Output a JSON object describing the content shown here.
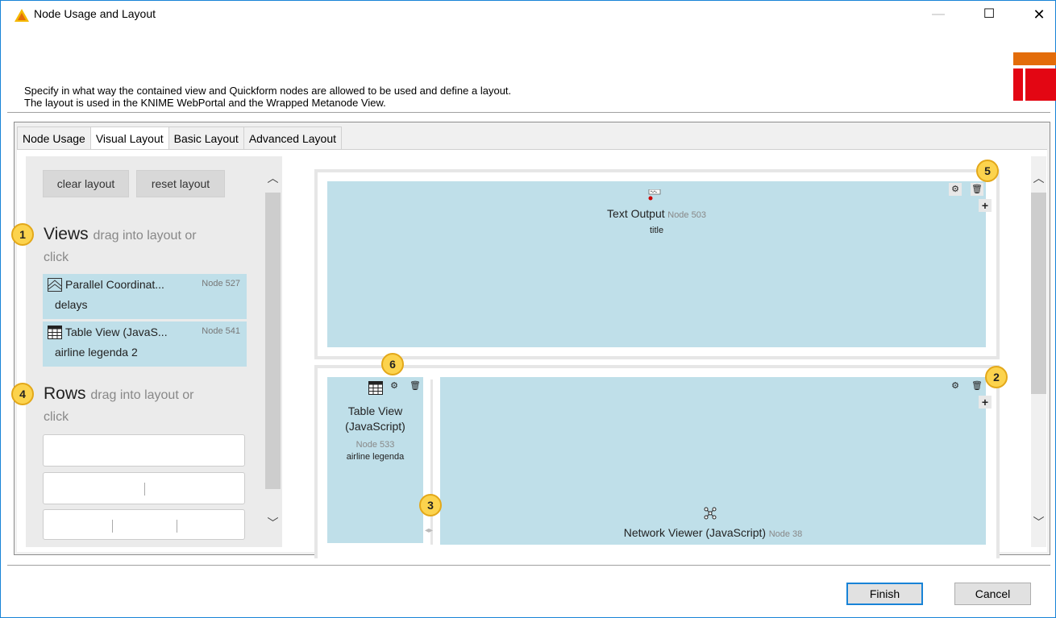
{
  "window": {
    "title": "Node Usage and Layout",
    "minimize": "—",
    "maximize": "☐",
    "close": "✕"
  },
  "header": {
    "line1": "Specify in what way the contained view and Quickform nodes are allowed to be used and define a layout.",
    "line2": "The layout is used in the KNIME WebPortal and the Wrapped Metanode View."
  },
  "tabs": [
    "Node Usage",
    "Visual Layout",
    "Basic Layout",
    "Advanced Layout"
  ],
  "left_panel": {
    "clear_label": "clear layout",
    "reset_label": "reset layout",
    "views_title": "Views",
    "views_hint": "drag into layout or",
    "views_click": "click",
    "views": [
      {
        "name": "Parallel Coordinat...",
        "node": "Node 527",
        "sub": "delays",
        "icon": "parallel-coordinates-icon"
      },
      {
        "name": "Table View (JavaS...",
        "node": "Node 541",
        "sub": "airline legenda 2",
        "icon": "table-icon"
      }
    ],
    "rows_title": "Rows",
    "rows_hint": "drag into layout or",
    "rows_click": "click"
  },
  "layout": {
    "row1": {
      "name": "Text Output",
      "node": "Node 503",
      "sub": "title",
      "icon": "text-output-icon"
    },
    "row2_col1": {
      "name1": "Table View",
      "name2": "(JavaScript)",
      "node": "Node 533",
      "sub": "airline legenda",
      "icon": "table-icon"
    },
    "row2_col2": {
      "name": "Network Viewer (JavaScript)",
      "node": "Node 38",
      "icon": "network-icon"
    }
  },
  "callouts": [
    "1",
    "2",
    "3",
    "4",
    "5",
    "6"
  ],
  "buttons": {
    "finish": "Finish",
    "cancel": "Cancel"
  },
  "colors": {
    "accent": "#1883d7",
    "view_tile": "#bfdfe9",
    "callout": "#fcd34d",
    "knime_orange": "#e36c0a",
    "knime_red": "#e30613"
  }
}
